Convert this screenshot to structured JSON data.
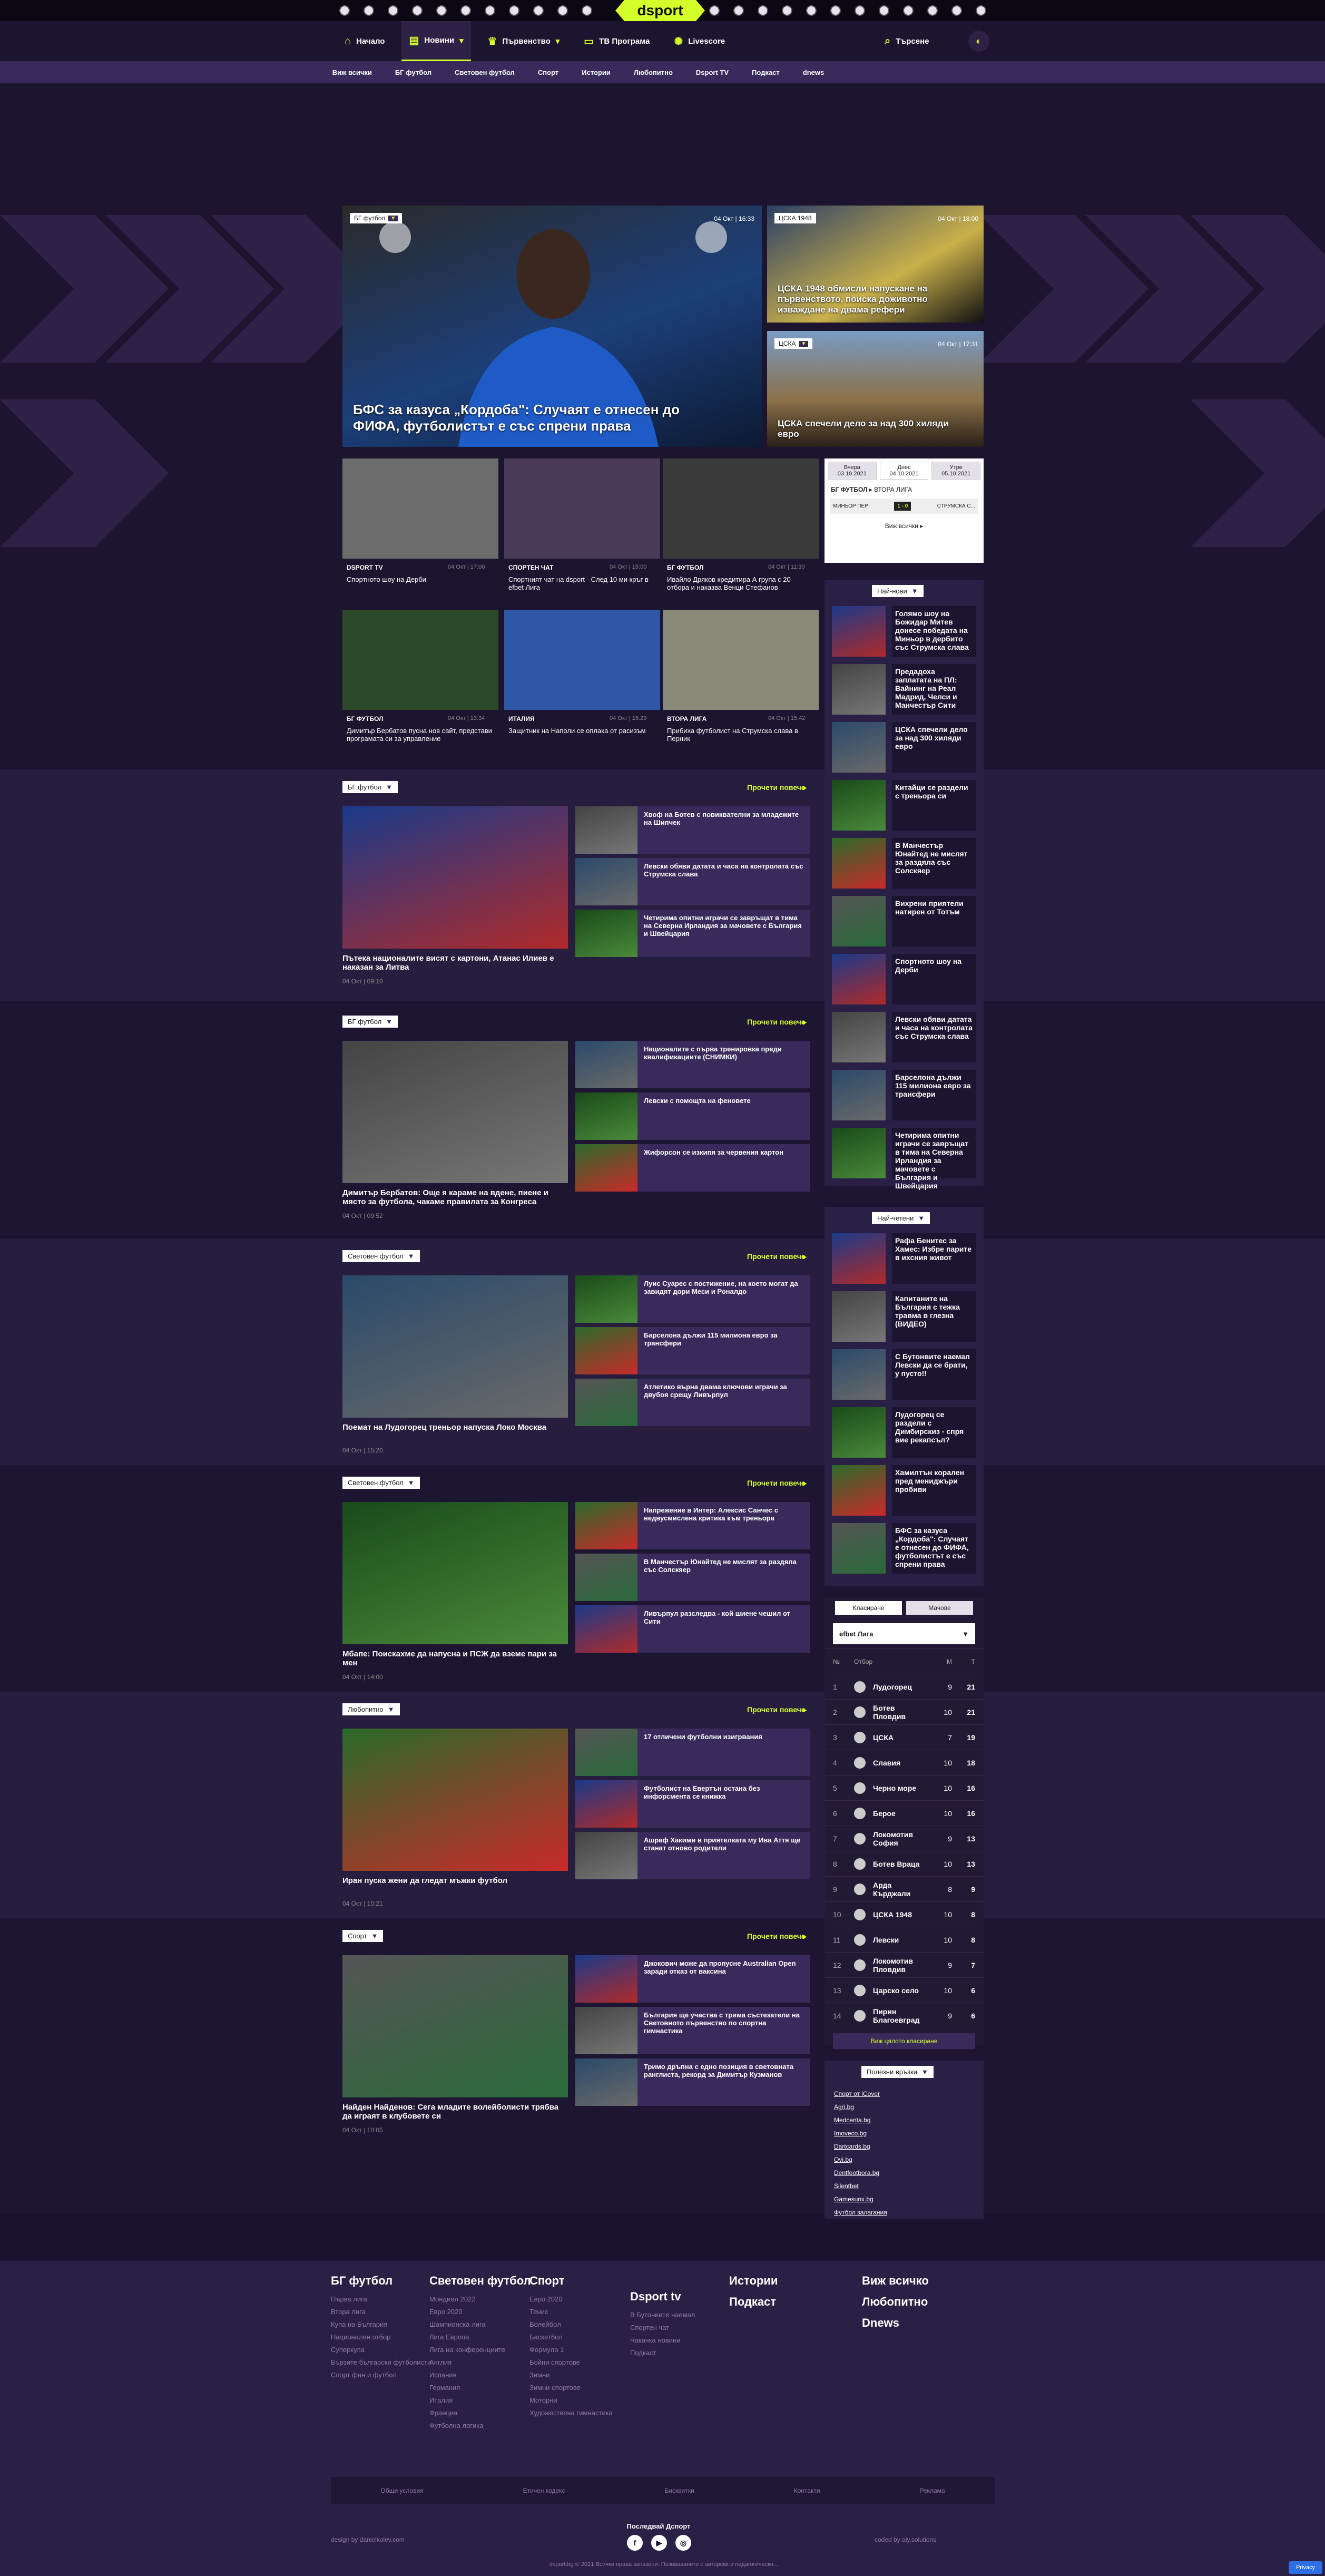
{
  "top": {
    "logo": "dsport",
    "clubs_count": 23
  },
  "nav": {
    "items": [
      {
        "label": "Начало",
        "icon": "home-icon"
      },
      {
        "label": "Новини",
        "icon": "news-icon",
        "active": true
      },
      {
        "label": "Първенство",
        "icon": "trophy-icon"
      },
      {
        "label": "ТВ Програма",
        "icon": "tv-icon"
      },
      {
        "label": "Livescore",
        "icon": "live-icon"
      }
    ],
    "search": "Търсене"
  },
  "subnav": [
    "Виж всички",
    "БГ футбол",
    "Световен футбол",
    "Спорт",
    "Истории",
    "Любопитно",
    "Dsport TV",
    "Подкаст",
    "dnews"
  ],
  "hero": {
    "main": {
      "tag": "БГ футбол",
      "date": "04 Окт | 16:33",
      "title": "БФС за казуса „Кордоба\": Случаят е отнесен до ФИФА, футболистът е със спрени права"
    },
    "r1": {
      "tag": "ЦСКА 1948",
      "date": "04 Окт | 18:00",
      "title": "ЦСКА 1948 обмисли напускане на първенството, поиска доживотно изваждане на двама рефери"
    },
    "r2": {
      "tag": "ЦСКА",
      "date": "04 Окт | 17:31",
      "title": "ЦСКА спечели дело за над 300 хиляди евро"
    }
  },
  "grid": [
    {
      "cat": "DSPORT TV",
      "date": "04 Окт | 17:00",
      "title": "Спортното шоу на Дерби"
    },
    {
      "cat": "СПОРТЕН ЧАТ",
      "date": "04 Окт | 15:00",
      "title": "Спортният чат на dsport - След 10 ми кръг в efbet Лига"
    },
    {
      "cat": "БГ ФУТБОЛ",
      "date": "04 Окт | 11:30",
      "title": "Ивайло Дряков кредитира А група с 20 отбора и наказва Венци Стефанов"
    },
    {
      "cat": "БГ ФУТБОЛ",
      "date": "04 Окт | 13:34",
      "title": "Димитър Бербатов пусна нов сайт, представи програмата си за управление"
    },
    {
      "cat": "ИТАЛИЯ",
      "date": "04 Окт | 15:29",
      "title": "Защитник на Наполи се оплака от расизъм"
    },
    {
      "cat": "ВТОРА ЛИГА",
      "date": "04 Окт | 15:42",
      "title": "Прибиха футболист на Струмска слава в Перник"
    }
  ],
  "dates": {
    "tabs": [
      [
        "Вчера",
        "03.10.2021"
      ],
      [
        "Днес",
        "04.10.2021"
      ],
      [
        "Утре",
        "05.10.2021"
      ]
    ],
    "match": {
      "league": "БГ ФУТБОЛ",
      "sub": "ВТОРА ЛИГА",
      "home": "МИНЬОР ПЕР",
      "score": "1 - 0",
      "away": "СТРУМСКА С..."
    },
    "all": "Виж всички"
  },
  "newest": {
    "label": "Най-нови",
    "items": [
      "Голямо шоу на Божидар Митев донесе победата на Миньор в дербито със Струмска слава",
      "Предадоха заплатата на ПЛ: Вайнинг на Реал Мадрид, Челси и Манчестър Сити",
      "ЦСКА спечели дело за над 300 хиляди евро",
      "Китайци се раздели с треньора си",
      "В Манчестър Юнайтед не мислят за раздяла със Солскяер",
      "Вихрени приятели натирен от Тотъм",
      "Спортното шоу на Дерби",
      "Левски обяви датата и часа на контролата със Струмска слава",
      "Барселона дължи 115 милиона евро за трансфери",
      "Четирима опитни играчи се завръщат в тима на Северна Ирландия за мачовете с България и Швейцария"
    ]
  },
  "most": {
    "label": "Най-четени",
    "items": [
      "Рафа Бенитес за Хамес: Избре парите в ихсния живот",
      "Капитаните на България с тежка травма в глезна (ВИДЕО)",
      "С Бутонвите наемал Левски да се брати, у пусто!!",
      "Лудогорец се раздели с Димбирскиз - спря вие рекапсъл?",
      "Хамилтън корален пред мениджъри пробиви",
      "БФС за казуса „Кордоба\": Случаят е отнесен до ФИФА, футболистът е със спрени права"
    ]
  },
  "sections": [
    {
      "tag": "БГ футбол",
      "more": "Прочети повече",
      "main": "Пътека националите висят с картони, Атанас Илиев е наказан за Литва",
      "date": "04 Окт | 09:10",
      "items": [
        "Хвоф на Ботев с повиквателни за младежите на Шипчек",
        "Левски обяви датата и часа на контролата със Струмска слава",
        "Четирима опитни играчи се завръщат в тима на Северна Ирландия за мачовете с България и Швейцария"
      ]
    },
    {
      "tag": "БГ футбол",
      "more": "Прочети повече",
      "main": "Димитър Бербатов: Още я караме на вдене, пиене и място за футбола, чакаме правилата за Конгреса",
      "date": "04 Окт | 09:52",
      "items": [
        "Националите с първа тренировка преди квалификациите (СНИМКИ)",
        "Левски с помощта на феновете",
        "Жифорсон се изкипя за червения картон"
      ]
    },
    {
      "tag": "Световен футбол",
      "more": "Прочети повече",
      "main": "Поемат на Лудогорец треньор напуска Локо Москва",
      "date": "04 Окт | 15:20",
      "items": [
        "Луис Суарес с постижение, на което могат да завидят дори Меси и Роналдо",
        "Барселона дължи 115 милиона евро за трансфери",
        "Атлетико върна двама ключови играчи за двубоя срещу Ливърпул"
      ]
    },
    {
      "tag": "Световен футбол",
      "more": "Прочети повече",
      "main": "Мбапе: Поискахме да напусна и ПСЖ да вземе пари за мен",
      "date": "04 Окт | 14:00",
      "items": [
        "Напрежение в Интер: Алексис Санчес с недвусмислена критика към треньора",
        "В Манчестър Юнайтед не мислят за раздяла със Солскяер",
        "Ливърпул разследва - кой шиене чешил от Сити"
      ]
    },
    {
      "tag": "Любопитно",
      "more": "Прочети повече",
      "main": "Иран пуска жени да гледат мъжки футбол",
      "date": "04 Окт | 10:21",
      "items": [
        "17 отличени футболни изигрвания",
        "Футболист на Евертън остана без инфорсмента се книжка",
        "Ашраф Хакими в приятелката му Ива Аття ще станат отново родители"
      ]
    },
    {
      "tag": "Спорт",
      "more": "Прочети повече",
      "main": "Найден Найденов: Сега младите волейболисти трябва да играят в клубовете си",
      "date": "04 Окт | 10:05",
      "items": [
        "Джокович може да пропусне Australian Open заради отказ от ваксина",
        "България ще участва с тримa състезатели на Световното първенство по спортна гимнастика",
        "Тримо дръпна с едно позиция в световната ранглиста, рекорд за Димитър Кузманов"
      ]
    }
  ],
  "table": {
    "tabs": [
      "Класиране",
      "Мачове"
    ],
    "league": "efbet Лига",
    "head": [
      "№",
      "Отбор",
      "М",
      "Т"
    ],
    "rows": [
      [
        "1",
        "Лудогорец",
        "9",
        "21"
      ],
      [
        "2",
        "Ботев Пловдив",
        "10",
        "21"
      ],
      [
        "3",
        "ЦСКА",
        "7",
        "19"
      ],
      [
        "4",
        "Славия",
        "10",
        "18"
      ],
      [
        "5",
        "Черно море",
        "10",
        "16"
      ],
      [
        "6",
        "Берое",
        "10",
        "16"
      ],
      [
        "7",
        "Локомотив София",
        "9",
        "13"
      ],
      [
        "8",
        "Ботев Враца",
        "10",
        "13"
      ],
      [
        "9",
        "Арда Кърджали",
        "8",
        "9"
      ],
      [
        "10",
        "ЦСКА 1948",
        "10",
        "8"
      ],
      [
        "11",
        "Левски",
        "10",
        "8"
      ],
      [
        "12",
        "Локомотив Пловдив",
        "9",
        "7"
      ],
      [
        "13",
        "Царско село",
        "10",
        "6"
      ],
      [
        "14",
        "Пирин Благоевград",
        "9",
        "6"
      ]
    ],
    "all": "Виж цялото класиране"
  },
  "links": {
    "label": "Полезни връзки",
    "items": [
      "Спорт от iCover",
      "Agri.bg",
      "Medcenta.bg",
      "Imoveco.bg",
      "Dartcards.bg",
      "Ovi.bg",
      "Dentfootbora.bg",
      "Silentbet",
      "Gamesunx.bg",
      "Футбол залагания"
    ]
  },
  "footer": {
    "cols": [
      {
        "h": "БГ футбол",
        "items": [
          "Първа лига",
          "Втора лига",
          "Купа на България",
          "Национален отбор",
          "Суперкупа",
          "Бързите български футболисти",
          "Спорт фан и футбол"
        ]
      },
      {
        "h": "Световен футбол",
        "items": [
          "Мондиал 2022",
          "Евро 2020",
          "Шампионска лига",
          "Лига Европа",
          "Лига на конференциите",
          "Англия",
          "Испания",
          "Германия",
          "Италия",
          "Франция",
          "Футболна логика"
        ]
      },
      {
        "h": "Спорт",
        "items": [
          "Евро 2020",
          "Тенис",
          "Волейбол",
          "Баскетбол",
          "Формула 1",
          "Бойни спортове",
          "Зимни",
          "Зимни спортове",
          "Моторни",
          "Художествена гимнастика"
        ]
      },
      {
        "h": "Dsport tv",
        "items": [
          "В Бутонвите наемал",
          "Спортен чат",
          "Чакачка новини",
          "Подкаст"
        ]
      },
      {
        "h": "Истории",
        "items": []
      },
      {
        "h": "Подкаст",
        "items": []
      },
      {
        "h": "Виж всичко",
        "items": []
      },
      {
        "h": "Любопитно",
        "items": []
      },
      {
        "h": "Dnews",
        "items": []
      }
    ],
    "bottom": [
      "Общи условия",
      "Етичен кодекс",
      "Бисквитки",
      "Контакти",
      "Реклама"
    ],
    "left": "design by danielkolev.com",
    "follow": "Последвай Дспорт",
    "social": [
      "f",
      "▶",
      "◎"
    ],
    "copy": "dsport.bg © 2021 Всички права запазени. Позоваването с авторски и педагогически...",
    "right": "coded by aly.solutions",
    "privacy": "Privacy"
  }
}
